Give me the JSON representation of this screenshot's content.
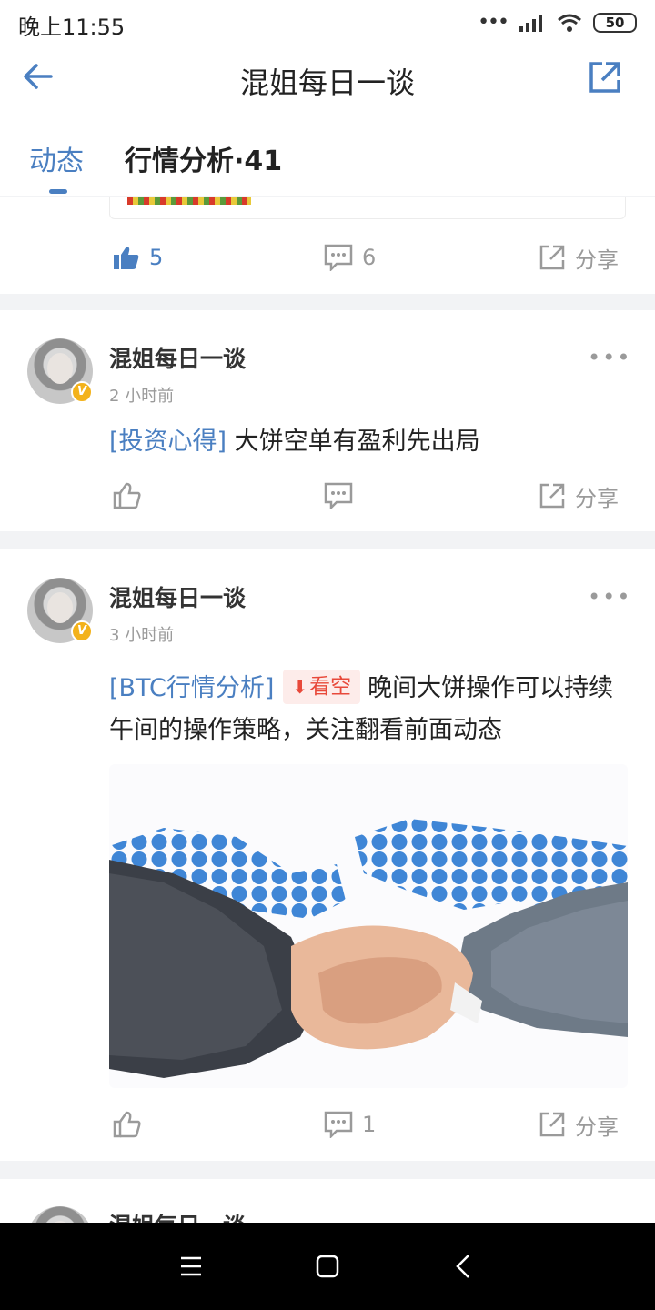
{
  "status_bar": {
    "time": "晚上11:55",
    "battery": "50"
  },
  "header": {
    "title": "混姐每日一谈"
  },
  "tabs": [
    {
      "label": "动态"
    },
    {
      "label": "行情分析·41"
    }
  ],
  "posts": [
    {
      "likes": "5",
      "comments": "6",
      "share_label": "分享"
    },
    {
      "author": "混姐每日一谈",
      "time": "2 小时前",
      "tag": "[投资心得]",
      "text": "大饼空单有盈利先出局",
      "share_label": "分享"
    },
    {
      "author": "混姐每日一谈",
      "time": "3 小时前",
      "tag": "[BTC行情分析]",
      "badge": "看空",
      "text": "晚间大饼操作可以持续午间的操作策略，关注翻看前面动态",
      "comments": "1",
      "share_label": "分享"
    },
    {
      "author": "混姐每日一谈"
    }
  ],
  "badge_letter": "V",
  "colors": {
    "accent": "#4a7fc1",
    "bearish": "#e8493a",
    "verified": "#f3b21b"
  }
}
